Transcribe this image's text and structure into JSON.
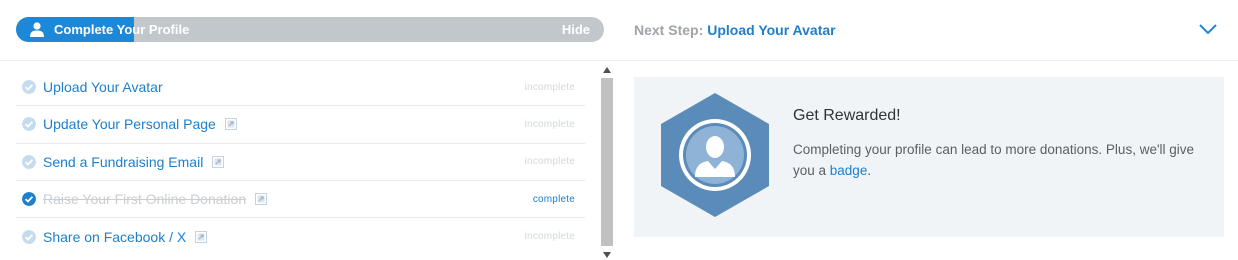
{
  "header": {
    "profile_title": "Complete Your Profile",
    "hide_label": "Hide",
    "progress_percent": 20,
    "next_step_label": "Next Step:",
    "next_step_link": "Upload Your Avatar"
  },
  "tasks": [
    {
      "label": "Upload Your Avatar",
      "status": "incomplete",
      "external": false,
      "done": false
    },
    {
      "label": "Update Your Personal Page",
      "status": "incomplete",
      "external": true,
      "done": false
    },
    {
      "label": "Send a Fundraising Email",
      "status": "incomplete",
      "external": true,
      "done": false
    },
    {
      "label": "Raise Your First Online Donation",
      "status": "complete",
      "external": true,
      "done": true
    },
    {
      "label": "Share on Facebook / X",
      "status": "incomplete",
      "external": true,
      "done": false
    }
  ],
  "reward": {
    "title": "Get Rewarded!",
    "desc_before": "Completing your profile can lead to more donations. Plus, we'll give you a ",
    "desc_link": "badge",
    "desc_after": "."
  },
  "colors": {
    "accent": "#1e88d8",
    "link": "#1e7fcb",
    "pill_bg": "#c1c7cb",
    "badge": "#5b8bb8"
  },
  "icons": {
    "pill": "user-icon",
    "next": "chevron-down-icon",
    "task_check": "check-circle-icon",
    "task_external": "external-link-icon",
    "badge": "avatar-badge-icon"
  }
}
